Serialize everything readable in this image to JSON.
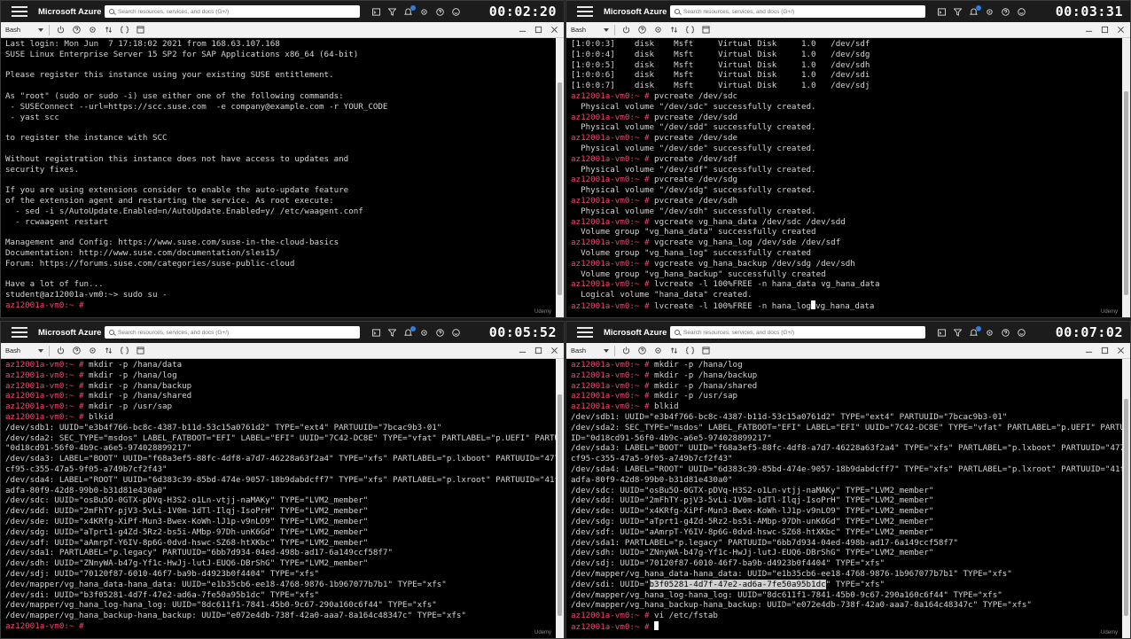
{
  "app": {
    "brand": "Microsoft Azure",
    "search_placeholder": "Search resources, services, and docs (G+/)",
    "shell": "Bash",
    "watermark": "Udemy"
  },
  "colors": {
    "prompt": "#f0486f",
    "terminal_bg": "#000000",
    "topbar_bg": "#1c1c1c"
  },
  "icons": {
    "topbar": [
      "cloud-shell-icon",
      "directory-filter-icon",
      "notifications-icon",
      "settings-icon",
      "help-icon",
      "feedback-icon"
    ],
    "toolbar": [
      "power-icon",
      "help-icon",
      "settings-icon",
      "upload-download-icon",
      "open-editor-icon",
      "web-preview-icon"
    ],
    "window": [
      "minimize-icon",
      "maximize-icon",
      "close-icon"
    ]
  },
  "panes": [
    {
      "timer": "00:02:20",
      "lines": [
        {
          "t": "Last login: Mon Jun  7 17:18:02 2021 from 168.63.107.168"
        },
        {
          "t": "SUSE Linux Enterprise Server 15 SP2 for SAP Applications x86_64 (64-bit)"
        },
        {
          "t": ""
        },
        {
          "t": "Please register this instance using your existing SUSE entitlement."
        },
        {
          "t": ""
        },
        {
          "t": "As \"root\" (sudo or sudo -i) use either one of the following commands:"
        },
        {
          "t": " - SUSEConnect --url=https://scc.suse.com  -e company@example.com -r YOUR_CODE"
        },
        {
          "t": " - yast scc"
        },
        {
          "t": ""
        },
        {
          "t": "to register the instance with SCC"
        },
        {
          "t": ""
        },
        {
          "t": "Without registration this instance does not have access to updates and"
        },
        {
          "t": "security fixes."
        },
        {
          "t": ""
        },
        {
          "t": "If you are using extensions consider to enable the auto-update feature"
        },
        {
          "t": "of the extension agent and restarting the service. As root execute:"
        },
        {
          "t": "  - sed -i s/AutoUpdate.Enabled=n/AutoUpdate.Enabled=y/ /etc/waagent.conf"
        },
        {
          "t": "  - rcwaagent restart"
        },
        {
          "t": ""
        },
        {
          "t": "Management and Config: https://www.suse.com/suse-in-the-cloud-basics"
        },
        {
          "t": "Documentation: http://www.suse.com/documentation/sles15/"
        },
        {
          "t": "Forum: https://forums.suse.com/categories/suse-public-cloud"
        },
        {
          "t": ""
        },
        {
          "t": "Have a lot of fun..."
        },
        {
          "t": "student@az12001a-vm0:~> sudo su -"
        },
        {
          "p": "az12001a-vm0:~ #",
          "t": ""
        }
      ]
    },
    {
      "timer": "00:03:31",
      "lines": [
        {
          "t": "[1:0:0:3]    disk    Msft     Virtual Disk     1.0   /dev/sdf"
        },
        {
          "t": "[1:0:0:4]    disk    Msft     Virtual Disk     1.0   /dev/sdg"
        },
        {
          "t": "[1:0:0:5]    disk    Msft     Virtual Disk     1.0   /dev/sdh"
        },
        {
          "t": "[1:0:0:6]    disk    Msft     Virtual Disk     1.0   /dev/sdi"
        },
        {
          "t": "[1:0:0:7]    disk    Msft     Virtual Disk     1.0   /dev/sdj"
        },
        {
          "p": "az12001a-vm0:~ #",
          "t": " pvcreate /dev/sdc"
        },
        {
          "t": "  Physical volume \"/dev/sdc\" successfully created."
        },
        {
          "p": "az12001a-vm0:~ #",
          "t": " pvcreate /dev/sdd"
        },
        {
          "t": "  Physical volume \"/dev/sdd\" successfully created."
        },
        {
          "p": "az12001a-vm0:~ #",
          "t": " pvcreate /dev/sde"
        },
        {
          "t": "  Physical volume \"/dev/sde\" successfully created."
        },
        {
          "p": "az12001a-vm0:~ #",
          "t": " pvcreate /dev/sdf"
        },
        {
          "t": "  Physical volume \"/dev/sdf\" successfully created."
        },
        {
          "p": "az12001a-vm0:~ #",
          "t": " pvcreate /dev/sdg"
        },
        {
          "t": "  Physical volume \"/dev/sdg\" successfully created."
        },
        {
          "p": "az12001a-vm0:~ #",
          "t": " pvcreate /dev/sdh"
        },
        {
          "t": "  Physical volume \"/dev/sdh\" successfully created."
        },
        {
          "p": "az12001a-vm0:~ #",
          "t": " vgcreate vg_hana_data /dev/sdc /dev/sdd"
        },
        {
          "t": "  Volume group \"vg_hana_data\" successfully created"
        },
        {
          "p": "az12001a-vm0:~ #",
          "t": " vgcreate vg_hana_log /dev/sde /dev/sdf"
        },
        {
          "t": "  Volume group \"vg_hana_log\" successfully created"
        },
        {
          "p": "az12001a-vm0:~ #",
          "t": " vgcreate vg_hana_backup /dev/sdg /dev/sdh"
        },
        {
          "t": "  Volume group \"vg_hana_backup\" successfully created"
        },
        {
          "p": "az12001a-vm0:~ #",
          "t": " lvcreate -l 100%FREE -n hana_data vg_hana_data"
        },
        {
          "t": "  Logical volume \"hana_data\" created."
        },
        {
          "p": "az12001a-vm0:~ #",
          "t": " lvcreate -l 100%FREE -n hana_log",
          "cur": true,
          "t2": "vg_hana_data"
        }
      ]
    },
    {
      "timer": "00:05:52",
      "lines": [
        {
          "p": "az12001a-vm0:~ #",
          "t": " mkdir -p /hana/data"
        },
        {
          "p": "az12001a-vm0:~ #",
          "t": " mkdir -p /hana/log"
        },
        {
          "p": "az12001a-vm0:~ #",
          "t": " mkdir -p /hana/backup"
        },
        {
          "p": "az12001a-vm0:~ #",
          "t": " mkdir -p /hana/shared"
        },
        {
          "p": "az12001a-vm0:~ #",
          "t": " mkdir -p /usr/sap"
        },
        {
          "p": "az12001a-vm0:~ #",
          "t": " blkid"
        },
        {
          "t": "/dev/sdb1: UUID=\"e3b4f766-bc8c-4387-b11d-53c15a0761d2\" TYPE=\"ext4\" PARTUUID=\"7bcac9b3-01\""
        },
        {
          "t": "/dev/sda2: SEC_TYPE=\"msdos\" LABEL_FATBOOT=\"EFI\" LABEL=\"EFI\" UUID=\"7C42-DC8E\" TYPE=\"vfat\" PARTLABEL=\"p.UEFI\" PARTUUID=\""
        },
        {
          "t": "\"0d18cd91-56f0-4b9c-a6e5-974028899217\""
        },
        {
          "t": "/dev/sda3: LABEL=\"BOOT\" UUID=\"f68a3ef5-88fc-4df8-a7d7-46228a63f2a4\" TYPE=\"xfs\" PARTLABEL=\"p.lxboot\" PARTUUID=\"477c"
        },
        {
          "t": "cf95-c355-47a5-9f05-a749b7cf2f43\""
        },
        {
          "t": "/dev/sda4: LABEL=\"ROOT\" UUID=\"6d383c39-85bd-474e-9057-18b9dabdcff7\" TYPE=\"xfs\" PARTLABEL=\"p.lxroot\" PARTUUID=\"41ff"
        },
        {
          "t": "adfa-80f9-42d8-99b0-b31d81e430a0\""
        },
        {
          "t": "/dev/sdc: UUID=\"osBu5O-0GTX-pDVq-H3S2-o1Ln-vtjj-naMAKy\" TYPE=\"LVM2_member\""
        },
        {
          "t": "/dev/sdd: UUID=\"2mFhTY-pjV3-5vLi-1V0m-1dTl-Ilqj-IsoPrH\" TYPE=\"LVM2_member\""
        },
        {
          "t": "/dev/sde: UUID=\"x4KRfg-XiPf-Mun3-Bwex-KoWh-lJ1p-v9nLO9\" TYPE=\"LVM2_member\""
        },
        {
          "t": "/dev/sdg: UUID=\"aTprt1-g4Zd-5Rz2-bs5i-AMbp-97Dh-unK6Gd\" TYPE=\"LVM2_member\""
        },
        {
          "t": "/dev/sdf: UUID=\"aAmrpT-Y6IV-8p6G-0dvd-hswc-SZ68-htXKbc\" TYPE=\"LVM2_member\""
        },
        {
          "t": "/dev/sda1: PARTLABEL=\"p.legacy\" PARTUUID=\"6bb7d934-04ed-498b-ad17-6a149ccf58f7\""
        },
        {
          "t": "/dev/sdh: UUID=\"ZNnyWA-b47g-Yf1c-HwJj-lutJ-EUQ6-DBrShG\" TYPE=\"LVM2_member\""
        },
        {
          "t": "/dev/sdj: UUID=\"70120f87-6010-46f7-ba9b-d4923b0f4404\" TYPE=\"xfs\""
        },
        {
          "t": "/dev/mapper/vg_hana_data-hana_data: UUID=\"e1b35cb6-ee18-4768-9876-1b967077b7b1\" TYPE=\"xfs\""
        },
        {
          "t": "/dev/sdi: UUID=\"b3f05281-4d7f-47e2-ad6a-7fe50a95b1dc\" TYPE=\"xfs\""
        },
        {
          "t": "/dev/mapper/vg_hana_log-hana_log: UUID=\"8dc611f1-7841-45b0-9c67-290a160c6f44\" TYPE=\"xfs\""
        },
        {
          "t": "/dev/mapper/vg_hana_backup-hana_backup: UUID=\"e072e4db-738f-42a0-aaa7-8a164c48347c\" TYPE=\"xfs\""
        },
        {
          "p": "az12001a-vm0:~ #",
          "t": ""
        }
      ]
    },
    {
      "timer": "00:07:02",
      "lines": [
        {
          "p": "az12001a-vm0:~ #",
          "t": " mkdir -p /hana/log"
        },
        {
          "p": "az12001a-vm0:~ #",
          "t": " mkdir -p /hana/backup"
        },
        {
          "p": "az12001a-vm0:~ #",
          "t": " mkdir -p /hana/shared"
        },
        {
          "p": "az12001a-vm0:~ #",
          "t": " mkdir -p /usr/sap"
        },
        {
          "p": "az12001a-vm0:~ #",
          "t": " blkid"
        },
        {
          "t": "/dev/sdb1: UUID=\"e3b4f766-bc8c-4387-b11d-53c15a0761d2\" TYPE=\"ext4\" PARTUUID=\"7bcac9b3-01\""
        },
        {
          "t": "/dev/sda2: SEC_TYPE=\"msdos\" LABEL_FATBOOT=\"EFI\" LABEL=\"EFI\" UUID=\"7C42-DC8E\" TYPE=\"vfat\" PARTLABEL=\"p.UEFI\" PARTUU"
        },
        {
          "t": "ID=\"0d18cd91-56f0-4b9c-a6e5-974028899217\""
        },
        {
          "t": "/dev/sda3: LABEL=\"BOOT\" UUID=\"f68a3ef5-88fc-4df8-a7d7-46228a63f2a4\" TYPE=\"xfs\" PARTLABEL=\"p.lxboot\" PARTUUID=\"477c"
        },
        {
          "t": "cf95-c355-47a5-9f05-a749b7cf2f43\""
        },
        {
          "t": "/dev/sda4: LABEL=\"ROOT\" UUID=\"6d383c39-85bd-474e-9057-18b9dabdcff7\" TYPE=\"xfs\" PARTLABEL=\"p.lxroot\" PARTUUID=\"41ff"
        },
        {
          "t": "adfa-80f9-42d8-99b0-b31d81e430a0\""
        },
        {
          "t": "/dev/sdc: UUID=\"osBu5O-0GTX-pDVq-H3S2-o1Ln-vtjj-naMAKy\" TYPE=\"LVM2_member\""
        },
        {
          "t": "/dev/sdd: UUID=\"2mFhTY-pjV3-5vLi-1V0m-1dTl-Ilqj-IsoPrH\" TYPE=\"LVM2_member\""
        },
        {
          "t": "/dev/sde: UUID=\"x4KRfg-XiPf-Mun3-Bwex-KoWh-lJ1p-v9nLO9\" TYPE=\"LVM2_member\""
        },
        {
          "t": "/dev/sdg: UUID=\"aTprt1-g4Zd-5Rz2-bs5i-AMbp-97Dh-unK6Gd\" TYPE=\"LVM2_member\""
        },
        {
          "t": "/dev/sdf: UUID=\"aAmrpT-Y6IV-8p6G-0dvd-hswc-SZ68-htXKbc\" TYPE=\"LVM2_member\""
        },
        {
          "t": "/dev/sda1: PARTLABEL=\"p.legacy\" PARTUUID=\"6bb7d934-04ed-498b-ad17-6a149ccf58f7\""
        },
        {
          "t": "/dev/sdh: UUID=\"ZNnyWA-b47g-Yf1c-HwJj-lutJ-EUQ6-DBrShG\" TYPE=\"LVM2_member\""
        },
        {
          "t": "/dev/sdj: UUID=\"70120f87-6010-46f7-ba9b-d4923b0f4404\" TYPE=\"xfs\""
        },
        {
          "t": "/dev/mapper/vg_hana_data-hana_data: UUID=\"e1b35cb6-ee18-4768-9876-1b967077b7b1\" TYPE=\"xfs\""
        },
        {
          "t": "/dev/sdi: UUID=\"",
          "hl": "b3f05281-4d7f-47e2-ad6a-7fe50a95b1dc",
          "t2": "\" TYPE=\"xfs\""
        },
        {
          "t": "/dev/mapper/vg_hana_log-hana_log: UUID=\"8dc611f1-7841-45b0-9c67-290a160c6f44\" TYPE=\"xfs\""
        },
        {
          "t": "/dev/mapper/vg_hana_backup-hana_backup: UUID=\"e072e4db-738f-42a0-aaa7-8a164c48347c\" TYPE=\"xfs\""
        },
        {
          "p": "az12001a-vm0:~ #",
          "t": " vi /etc/fstab"
        },
        {
          "p": "az12001a-vm0:~ #",
          "t": " ",
          "cur": true
        }
      ]
    }
  ]
}
